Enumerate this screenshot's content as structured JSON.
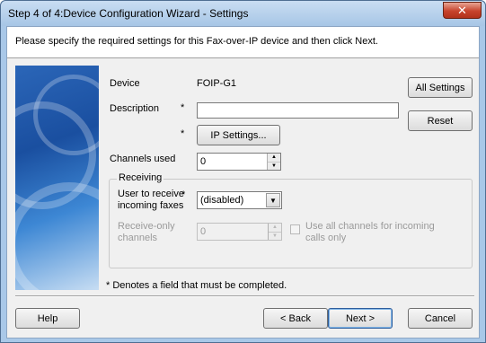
{
  "window": {
    "title": "Step 4 of 4:Device Configuration Wizard - Settings",
    "close_glyph": "✕"
  },
  "header": {
    "instructions": "Please specify the required settings for this Fax-over-IP device and then click Next."
  },
  "form": {
    "device_label": "Device",
    "device_value": "FOIP-G1",
    "description_label": "Description",
    "description_value": "",
    "required_marker": "*",
    "ip_settings_label": "IP Settings...",
    "channels_label": "Channels used",
    "channels_value": "0",
    "all_settings_label": "All Settings",
    "reset_label": "Reset"
  },
  "receiving": {
    "group_title": "Receiving",
    "user_label_line1": "User to receive",
    "user_label_line2": "incoming faxes",
    "user_value": "(disabled)",
    "receive_only_label_line1": "Receive-only",
    "receive_only_label_line2": "channels",
    "receive_only_value": "0",
    "use_all_line1": "Use all channels for incoming",
    "use_all_line2": "calls only",
    "use_all_checked": false
  },
  "footnote": "* Denotes a field that must be completed.",
  "buttons": {
    "help": "Help",
    "back": "< Back",
    "next": "Next >",
    "cancel": "Cancel"
  },
  "icons": {
    "spin_up": "▲",
    "spin_down": "▼",
    "dropdown": "▼"
  }
}
